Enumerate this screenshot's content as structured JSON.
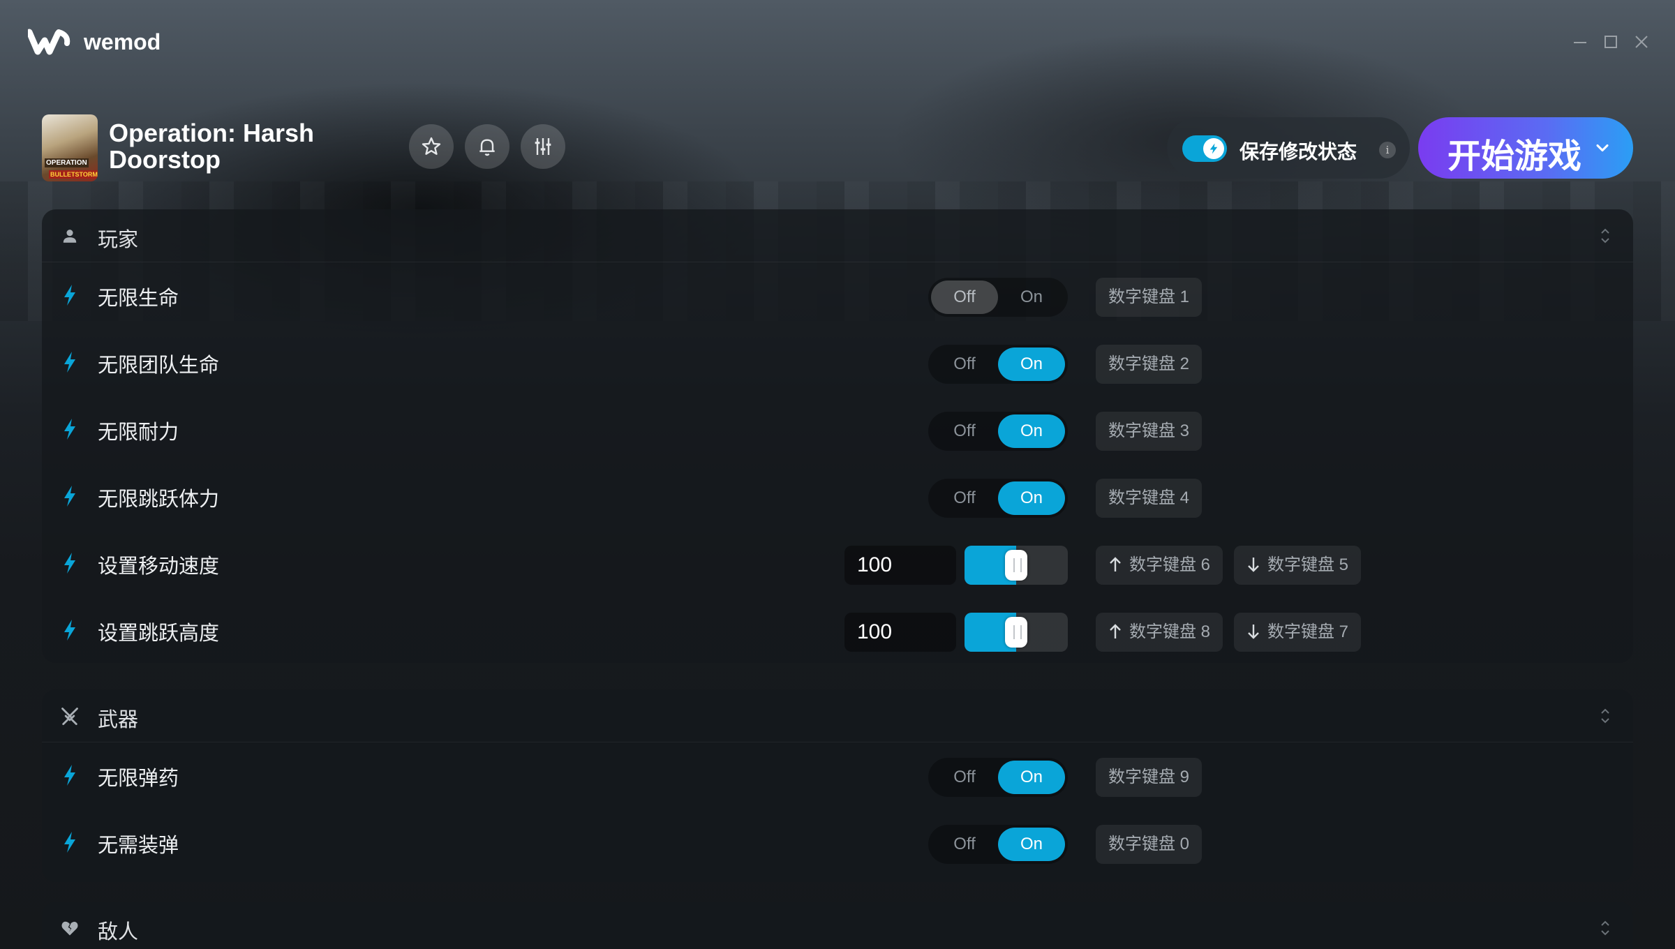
{
  "app": {
    "name": "wemod"
  },
  "game": {
    "title": "Operation: Harsh Doorstop",
    "cover_text_top": "OPERATION",
    "cover_text_bottom": "BULLETSTORM"
  },
  "header": {
    "save_mods_label": "保存修改状态",
    "save_mods_enabled": true,
    "info_glyph": "i",
    "play_label": "开始游戏"
  },
  "colors": {
    "accent": "#0aa5d8",
    "play_gradient_start": "#7a3cf0",
    "play_gradient_end": "#2b9ef5"
  },
  "sections": {
    "player": {
      "title": "玩家",
      "icon": "person-icon",
      "rows": [
        {
          "label": "无限生命",
          "type": "toggle",
          "off": "Off",
          "on": "On",
          "state": "off",
          "hotkey": "数字键盘 1"
        },
        {
          "label": "无限团队生命",
          "type": "toggle",
          "off": "Off",
          "on": "On",
          "state": "on",
          "hotkey": "数字键盘 2"
        },
        {
          "label": "无限耐力",
          "type": "toggle",
          "off": "Off",
          "on": "On",
          "state": "on",
          "hotkey": "数字键盘 3"
        },
        {
          "label": "无限跳跃体力",
          "type": "toggle",
          "off": "Off",
          "on": "On",
          "state": "on",
          "hotkey": "数字键盘 4"
        },
        {
          "label": "设置移动速度",
          "type": "slider",
          "value": "100",
          "slider_fraction": 0.5,
          "hotkey_up": "数字键盘 6",
          "hotkey_down": "数字键盘 5"
        },
        {
          "label": "设置跳跃高度",
          "type": "slider",
          "value": "100",
          "slider_fraction": 0.5,
          "hotkey_up": "数字键盘 8",
          "hotkey_down": "数字键盘 7"
        }
      ]
    },
    "weapons": {
      "title": "武器",
      "icon": "crossed-swords-icon",
      "rows": [
        {
          "label": "无限弹药",
          "type": "toggle",
          "off": "Off",
          "on": "On",
          "state": "on",
          "hotkey": "数字键盘 9"
        },
        {
          "label": "无需装弹",
          "type": "toggle",
          "off": "Off",
          "on": "On",
          "state": "on",
          "hotkey": "数字键盘 0"
        }
      ]
    },
    "enemies": {
      "title": "敌人",
      "icon": "broken-heart-icon"
    }
  }
}
